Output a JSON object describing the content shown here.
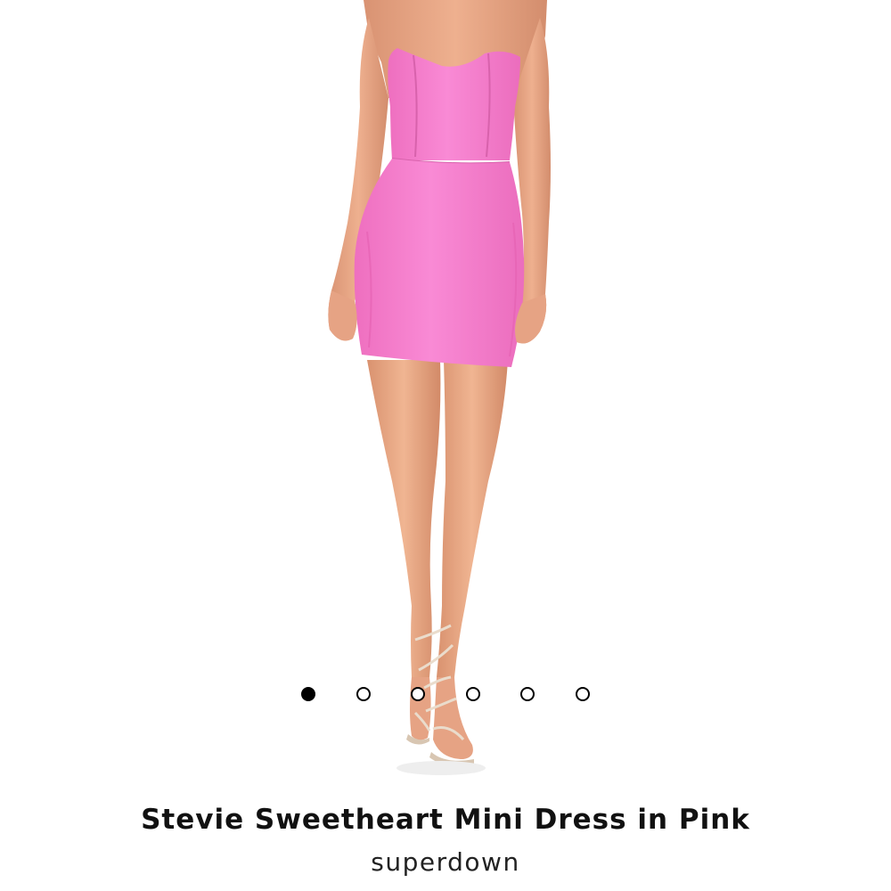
{
  "carousel": {
    "image_subject": "pink strapless mini dress",
    "dot_count": 6,
    "active_index": 0,
    "dress_color": "#f57fce",
    "skin_color": "#e8a582"
  },
  "product": {
    "title": "Stevie Sweetheart Mini Dress in Pink",
    "brand": "superdown"
  }
}
